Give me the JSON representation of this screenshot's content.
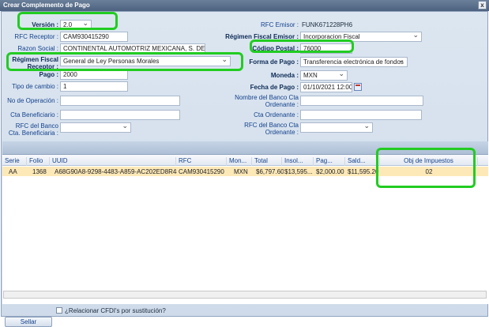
{
  "window": {
    "title": "Crear Complemento de Pago",
    "close_label": "x"
  },
  "form": {
    "version": {
      "label": "Versión :",
      "value": "2.0"
    },
    "rfc_receptor": {
      "label": "RFC Receptor :",
      "value": "CAM930415290"
    },
    "razon_social": {
      "label": "Razon Social :",
      "value": "CONTINENTAL AUTOMOTRIZ MEXICANA, S. DE R.L. I"
    },
    "regimen_fiscal_receptor": {
      "label": "Régimen Fiscal Receptor :",
      "value": "General de Ley Personas Morales"
    },
    "pago": {
      "label": "Pago :",
      "value": "2000"
    },
    "tipo_cambio": {
      "label": "Tipo de cambio :",
      "value": "1"
    },
    "no_operacion": {
      "label": "No de Operación :",
      "value": ""
    },
    "cta_beneficiario": {
      "label": "Cta Beneficiario :",
      "value": ""
    },
    "rfc_banco_beneficiario": {
      "label": "RFC del Banco Cta. Beneficiaria :",
      "value": ""
    },
    "rfc_emisor": {
      "label": "RFC Emisor :",
      "value": "FUNK671228PH6"
    },
    "regimen_fiscal_emisor": {
      "label": "Régimen Fiscal Emisor :",
      "value": "Incorporacion Fiscal"
    },
    "codigo_postal": {
      "label": "Código Postal :",
      "value": "76000"
    },
    "forma_pago": {
      "label": "Forma de Pago :",
      "value": "Transferencia electrónica de fondos"
    },
    "moneda": {
      "label": "Moneda :",
      "value": "MXN"
    },
    "fecha_pago": {
      "label": "Fecha de Pago :",
      "value": "01/10/2021 12:00"
    },
    "nombre_banco_ordenante": {
      "label": "Nombre del Banco Cta Ordenante :",
      "value": ""
    },
    "cta_ordenante": {
      "label": "Cta Ordenante :",
      "value": ""
    },
    "rfc_banco_ordenante": {
      "label": "RFC del Banco Cta Ordenante :",
      "value": ""
    }
  },
  "grid": {
    "columns": [
      "Serie",
      "Folio",
      "UUID",
      "RFC",
      "Mon...",
      "Total",
      "Insol...",
      "Pag...",
      "Sald...",
      "Obj de Impuestos"
    ],
    "rows": [
      [
        "AA",
        "1368",
        "A68G90A8-9298-4483-A859-AC202ED8R489",
        "CAM930415290",
        "MXN",
        "$6,797.60",
        "$13,595...",
        "$2,000.00",
        "$11,595.20",
        "02"
      ]
    ]
  },
  "footer": {
    "relacionar_label": "¿Relacionar CFDI's por sustitución?",
    "sellar_label": "Sellar"
  },
  "colors": {
    "highlight": "#22cc22",
    "selected_row": "#fde9b8",
    "label": "#15428b"
  }
}
